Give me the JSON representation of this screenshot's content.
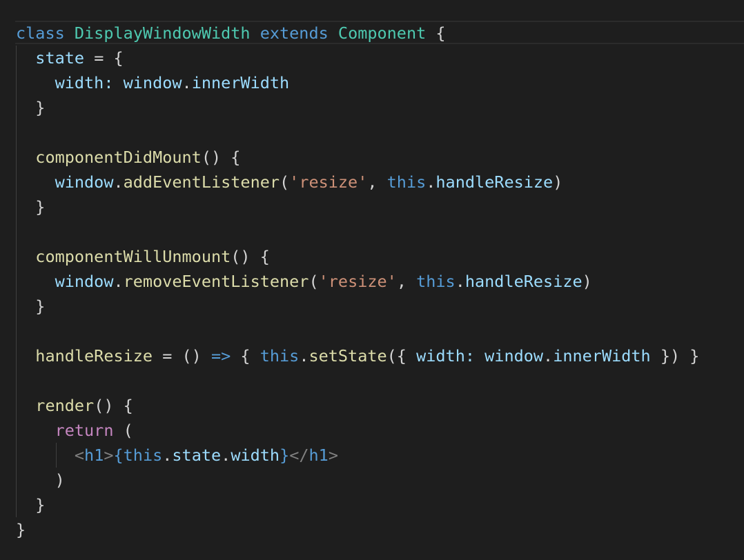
{
  "editor": {
    "background": "#1e1e1e",
    "lines": [
      {
        "tokens": [
          {
            "t": "class ",
            "c": "kw"
          },
          {
            "t": "DisplayWindowWidth",
            "c": "cls"
          },
          {
            "t": " ",
            "c": "punct"
          },
          {
            "t": "extends",
            "c": "kw"
          },
          {
            "t": " ",
            "c": "punct"
          },
          {
            "t": "Component",
            "c": "cls"
          },
          {
            "t": " {",
            "c": "punct"
          }
        ]
      },
      {
        "tokens": [
          {
            "t": "  state",
            "c": "prop"
          },
          {
            "t": " = {",
            "c": "punct"
          }
        ]
      },
      {
        "tokens": [
          {
            "t": "    width",
            "c": "prop"
          },
          {
            "t": ": ",
            "c": "prop"
          },
          {
            "t": "window",
            "c": "prop"
          },
          {
            "t": ".",
            "c": "punct"
          },
          {
            "t": "innerWidth",
            "c": "prop"
          }
        ]
      },
      {
        "tokens": [
          {
            "t": "  }",
            "c": "punct"
          }
        ]
      },
      {
        "tokens": []
      },
      {
        "tokens": [
          {
            "t": "  componentDidMount",
            "c": "fn"
          },
          {
            "t": "() {",
            "c": "punct"
          }
        ]
      },
      {
        "tokens": [
          {
            "t": "    window",
            "c": "prop"
          },
          {
            "t": ".",
            "c": "punct"
          },
          {
            "t": "addEventListener",
            "c": "fn"
          },
          {
            "t": "(",
            "c": "punct"
          },
          {
            "t": "'resize'",
            "c": "str"
          },
          {
            "t": ", ",
            "c": "punct"
          },
          {
            "t": "this",
            "c": "kw"
          },
          {
            "t": ".",
            "c": "punct"
          },
          {
            "t": "handleResize",
            "c": "prop"
          },
          {
            "t": ")",
            "c": "punct"
          }
        ]
      },
      {
        "tokens": [
          {
            "t": "  }",
            "c": "punct"
          }
        ]
      },
      {
        "tokens": []
      },
      {
        "tokens": [
          {
            "t": "  componentWillUnmount",
            "c": "fn"
          },
          {
            "t": "() {",
            "c": "punct"
          }
        ]
      },
      {
        "tokens": [
          {
            "t": "    window",
            "c": "prop"
          },
          {
            "t": ".",
            "c": "punct"
          },
          {
            "t": "removeEventListener",
            "c": "fn"
          },
          {
            "t": "(",
            "c": "punct"
          },
          {
            "t": "'resize'",
            "c": "str"
          },
          {
            "t": ", ",
            "c": "punct"
          },
          {
            "t": "this",
            "c": "kw"
          },
          {
            "t": ".",
            "c": "punct"
          },
          {
            "t": "handleResize",
            "c": "prop"
          },
          {
            "t": ")",
            "c": "punct"
          }
        ]
      },
      {
        "tokens": [
          {
            "t": "  }",
            "c": "punct"
          }
        ]
      },
      {
        "tokens": []
      },
      {
        "tokens": [
          {
            "t": "  handleResize",
            "c": "fn"
          },
          {
            "t": " = () ",
            "c": "punct"
          },
          {
            "t": "=>",
            "c": "kw"
          },
          {
            "t": " { ",
            "c": "punct"
          },
          {
            "t": "this",
            "c": "kw"
          },
          {
            "t": ".",
            "c": "punct"
          },
          {
            "t": "setState",
            "c": "fn"
          },
          {
            "t": "({ ",
            "c": "punct"
          },
          {
            "t": "width",
            "c": "prop"
          },
          {
            "t": ": ",
            "c": "prop"
          },
          {
            "t": "window",
            "c": "prop"
          },
          {
            "t": ".",
            "c": "punct"
          },
          {
            "t": "innerWidth",
            "c": "prop"
          },
          {
            "t": " }) }",
            "c": "punct"
          }
        ]
      },
      {
        "tokens": []
      },
      {
        "tokens": [
          {
            "t": "  render",
            "c": "fn"
          },
          {
            "t": "() {",
            "c": "punct"
          }
        ]
      },
      {
        "tokens": [
          {
            "t": "    ",
            "c": "punct"
          },
          {
            "t": "return",
            "c": "ctrl"
          },
          {
            "t": " (",
            "c": "punct"
          }
        ]
      },
      {
        "tokens": [
          {
            "t": "      ",
            "c": "punct"
          },
          {
            "t": "<",
            "c": "tagbr"
          },
          {
            "t": "h1",
            "c": "tag"
          },
          {
            "t": ">",
            "c": "tagbr"
          },
          {
            "t": "{",
            "c": "kw"
          },
          {
            "t": "this",
            "c": "kw"
          },
          {
            "t": ".",
            "c": "punct"
          },
          {
            "t": "state",
            "c": "prop"
          },
          {
            "t": ".",
            "c": "punct"
          },
          {
            "t": "width",
            "c": "prop"
          },
          {
            "t": "}",
            "c": "kw"
          },
          {
            "t": "</",
            "c": "tagbr"
          },
          {
            "t": "h1",
            "c": "tag"
          },
          {
            "t": ">",
            "c": "tagbr"
          }
        ]
      },
      {
        "tokens": [
          {
            "t": "    )",
            "c": "punct"
          }
        ]
      },
      {
        "tokens": [
          {
            "t": "  }",
            "c": "punct"
          }
        ]
      },
      {
        "tokens": [
          {
            "t": "}",
            "c": "punct"
          }
        ]
      }
    ]
  }
}
